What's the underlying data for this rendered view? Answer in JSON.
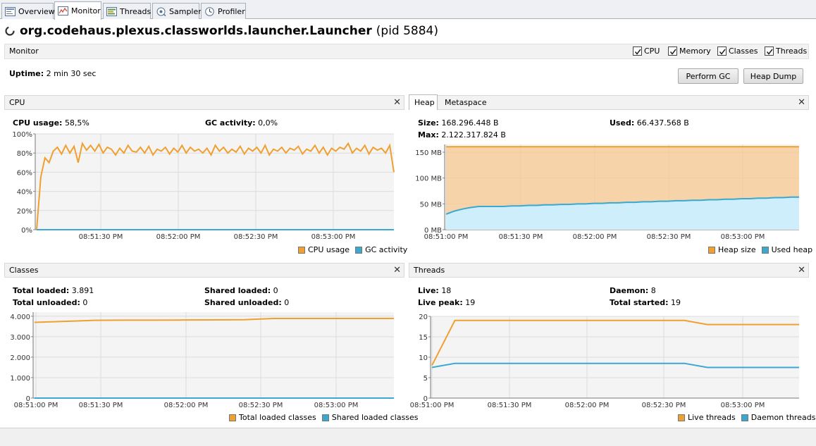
{
  "tabs": [
    {
      "label": "Overview",
      "icon": "overview-icon"
    },
    {
      "label": "Monitor",
      "icon": "monitor-icon"
    },
    {
      "label": "Threads",
      "icon": "threads-icon"
    },
    {
      "label": "Sampler",
      "icon": "sampler-icon"
    },
    {
      "label": "Profiler",
      "icon": "profiler-icon"
    }
  ],
  "app": {
    "name": "org.codehaus.plexus.classworlds.launcher.Launcher",
    "pid": "(pid 5884)"
  },
  "monitor": {
    "title": "Monitor",
    "checkboxes": [
      {
        "label": "CPU",
        "checked": true
      },
      {
        "label": "Memory",
        "checked": true
      },
      {
        "label": "Classes",
        "checked": true
      },
      {
        "label": "Threads",
        "checked": true
      }
    ],
    "uptime_label": "Uptime:",
    "uptime_value": "2 min 30 sec",
    "perform_gc": "Perform GC",
    "heap_dump": "Heap Dump"
  },
  "colors": {
    "orange": "#f0a030",
    "blue": "#3aa8d0",
    "orange_fill": "#f7c890",
    "blue_fill": "#cdeefa"
  },
  "cpu": {
    "title": "CPU",
    "usage_label": "CPU usage:",
    "usage_value": "58,5%",
    "gc_label": "GC activity:",
    "gc_value": "0,0%",
    "legend": [
      "CPU usage",
      "GC activity"
    ]
  },
  "heap": {
    "tabs": [
      "Heap",
      "Metaspace"
    ],
    "size_label": "Size:",
    "size_value": "168.296.448 B",
    "max_label": "Max:",
    "max_value": "2.122.317.824 B",
    "used_label": "Used:",
    "used_value": "66.437.568 B",
    "legend": [
      "Heap size",
      "Used heap"
    ]
  },
  "classes": {
    "title": "Classes",
    "total_loaded_label": "Total loaded:",
    "total_loaded_value": "3.891",
    "total_unloaded_label": "Total unloaded:",
    "total_unloaded_value": "0",
    "shared_loaded_label": "Shared loaded:",
    "shared_loaded_value": "0",
    "shared_unloaded_label": "Shared unloaded:",
    "shared_unloaded_value": "0",
    "legend": [
      "Total loaded classes",
      "Shared loaded classes"
    ]
  },
  "threads": {
    "title": "Threads",
    "live_label": "Live:",
    "live_value": "18",
    "peak_label": "Live peak:",
    "peak_value": "19",
    "daemon_label": "Daemon:",
    "daemon_value": "8",
    "started_label": "Total started:",
    "started_value": "19",
    "legend": [
      "Live threads",
      "Daemon threads"
    ]
  },
  "chart_data": [
    {
      "type": "line",
      "title": "CPU",
      "x_ticks": [
        "08:51:30 PM",
        "08:52:00 PM",
        "08:52:30 PM",
        "08:53:00 PM"
      ],
      "y_ticks": [
        "0%",
        "20%",
        "40%",
        "60%",
        "80%",
        "100%"
      ],
      "ylim": [
        0,
        100
      ],
      "series": [
        {
          "name": "CPU usage",
          "color": "#f0a030",
          "values": [
            0,
            55,
            75,
            70,
            82,
            86,
            79,
            88,
            80,
            87,
            70,
            90,
            83,
            88,
            82,
            89,
            80,
            86,
            84,
            78,
            85,
            80,
            88,
            82,
            81,
            86,
            80,
            87,
            78,
            84,
            82,
            86,
            79,
            85,
            81,
            88,
            80,
            86,
            82,
            84,
            80,
            85,
            78,
            88,
            82,
            86,
            80,
            84,
            81,
            87,
            79,
            85,
            82,
            86,
            80,
            88,
            78,
            84,
            82,
            86,
            80,
            85,
            83,
            87,
            79,
            84,
            82,
            88,
            80,
            86,
            78,
            85,
            82,
            86,
            84,
            90,
            80,
            85,
            82,
            88,
            79,
            86,
            83,
            85,
            80,
            88,
            60
          ]
        },
        {
          "name": "GC activity",
          "color": "#3aa8d0",
          "values": [
            0,
            0
          ]
        }
      ]
    },
    {
      "type": "area",
      "title": "Heap",
      "x_ticks": [
        "08:51:00 PM",
        "08:51:30 PM",
        "08:52:00 PM",
        "08:52:30 PM",
        "08:53:00 PM"
      ],
      "y_ticks": [
        "0 MB",
        "50 MB",
        "100 MB",
        "150 MB"
      ],
      "ylim": [
        0,
        165
      ],
      "series": [
        {
          "name": "Heap size",
          "color": "#f0a030",
          "values": [
            160.5,
            160.5
          ]
        },
        {
          "name": "Used heap",
          "color": "#3aa8d0",
          "values": [
            30,
            36,
            40,
            43,
            45,
            45,
            45,
            45,
            46,
            46,
            47,
            47,
            48,
            48,
            49,
            49,
            50,
            50,
            51,
            51,
            52,
            52,
            53,
            53,
            54,
            54,
            55,
            55,
            56,
            56,
            57,
            57,
            58,
            58,
            59,
            59,
            60,
            60,
            61,
            61,
            62,
            62,
            63,
            63
          ]
        }
      ]
    },
    {
      "type": "line",
      "title": "Classes",
      "x_ticks": [
        "08:51:00 PM",
        "08:51:30 PM",
        "08:52:00 PM",
        "08:52:30 PM",
        "08:53:00 PM"
      ],
      "y_ticks": [
        "0",
        "1.000",
        "2.000",
        "3.000",
        "4.000"
      ],
      "ylim": [
        0,
        4200
      ],
      "series": [
        {
          "name": "Total loaded classes",
          "color": "#f0a030",
          "values": [
            3700,
            3750,
            3800,
            3810,
            3810,
            3815,
            3820,
            3830,
            3891,
            3891,
            3891,
            3891,
            3891
          ]
        },
        {
          "name": "Shared loaded classes",
          "color": "#3aa8d0",
          "values": [
            0,
            0
          ]
        }
      ]
    },
    {
      "type": "line",
      "title": "Threads",
      "x_ticks": [
        "08:51:00 PM",
        "08:51:30 PM",
        "08:52:00 PM",
        "08:52:30 PM",
        "08:53:00 PM"
      ],
      "y_ticks": [
        "0",
        "5",
        "10",
        "15",
        "20"
      ],
      "ylim": [
        0,
        20
      ],
      "series": [
        {
          "name": "Live threads",
          "color": "#f0a030",
          "values": [
            8,
            19,
            19,
            19,
            19,
            19,
            19,
            19,
            19,
            19,
            19,
            19,
            18,
            18,
            18,
            18,
            18
          ]
        },
        {
          "name": "Daemon threads",
          "color": "#3aa8d0",
          "values": [
            7.5,
            8.5,
            8.5,
            8.5,
            8.5,
            8.5,
            8.5,
            8.5,
            8.5,
            8.5,
            8.5,
            8.5,
            7.5,
            7.5,
            7.5,
            7.5,
            7.5
          ]
        }
      ]
    }
  ]
}
